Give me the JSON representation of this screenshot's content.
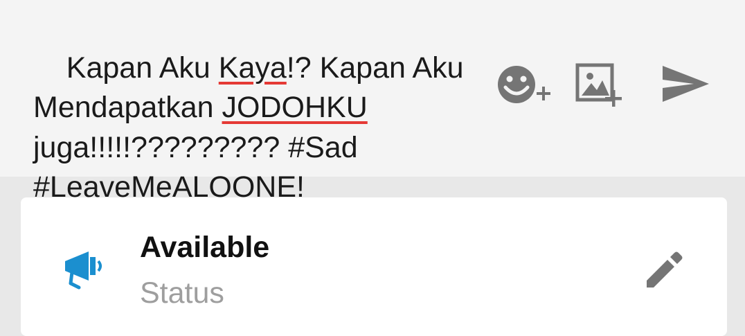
{
  "composer": {
    "text_parts": [
      {
        "text": "Kapan Aku "
      },
      {
        "text": "Kaya",
        "spellcheck": true
      },
      {
        "text": "!? Kapan Aku\n"
      },
      {
        "text": "Mendapatkan "
      },
      {
        "text": "JODOHKU",
        "spellcheck": true
      },
      {
        "text": "\njuga!!!!!????????? #Sad\n#"
      },
      {
        "text": "LeaveMeALOONE",
        "spellcheck": true
      },
      {
        "text": "!"
      }
    ],
    "buttons": [
      {
        "name": "add-emoji-button",
        "icon": "emoji-plus-icon"
      },
      {
        "name": "add-image-button",
        "icon": "image-plus-icon"
      },
      {
        "name": "send-button",
        "icon": "send-icon"
      }
    ]
  },
  "status_card": {
    "title": "Available",
    "subtitle": "Status",
    "icon": "megaphone-icon",
    "edit_icon": "pencil-icon"
  },
  "colors": {
    "icon_gray": "#757575",
    "accent_blue": "#1b8fcf",
    "spellcheck_red": "#e53935",
    "subtitle_gray": "#9e9e9e"
  }
}
